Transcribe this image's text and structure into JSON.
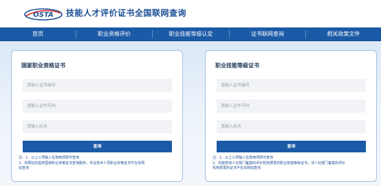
{
  "header": {
    "logo_text": "OSTA",
    "site_title": "技能人才评价证书全国联网查询"
  },
  "nav": {
    "items": [
      {
        "label": "首页"
      },
      {
        "label": "职业资格评价"
      },
      {
        "label": "职业技能等级认定"
      },
      {
        "label": "证书联网查询"
      },
      {
        "label": "相关政策文件"
      }
    ]
  },
  "cards": [
    {
      "title": "国家职业资格证书",
      "fields": [
        {
          "placeholder": "请输入证书编号",
          "value": ""
        },
        {
          "placeholder": "请输入证件号码",
          "value": ""
        },
        {
          "placeholder": "请输入姓名",
          "value": ""
        }
      ],
      "button_label": "查询",
      "notes": [
        "注：1、以上三项输入任意两项即可查询",
        "    2、本网站仅提供国家职业资格证书查询服务，专业技术人员职业资格证书不在本网",
        "    站查询"
      ]
    },
    {
      "title": "职业技能等级证书",
      "fields": [
        {
          "placeholder": "请输入证书编号",
          "value": ""
        },
        {
          "placeholder": "请输入证件号码",
          "value": ""
        },
        {
          "placeholder": "请输入姓名",
          "value": ""
        }
      ],
      "button_label": "查询",
      "notes": [
        "注：1、以上三项输入任意两项即可查询",
        "    2、仅能查询人社部门备案的评价机构颁发的职业技能等级证书，非人社部门备案的评价",
        "    机构颁发的证书不在本网站查询"
      ]
    }
  ],
  "colors": {
    "primary": "#1b5aa6",
    "title_blue": "#1b4f95",
    "card_border": "#9fc0e2",
    "input_bg": "#f1f3f6",
    "logo_red": "#d6252c"
  }
}
